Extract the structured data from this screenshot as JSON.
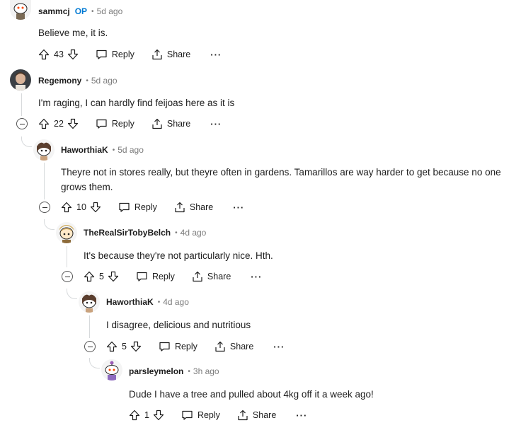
{
  "comments": [
    {
      "author": "sammcj",
      "op_label": "OP",
      "age": "5d ago",
      "body": "Believe me, it is.",
      "votes": "43",
      "reply": "Reply",
      "share": "Share"
    },
    {
      "author": "Regemony",
      "age": "5d ago",
      "body": "I'm raging, I can hardly find feijoas here as it is",
      "votes": "22",
      "reply": "Reply",
      "share": "Share"
    },
    {
      "author": "HaworthiaK",
      "age": "5d ago",
      "body": "Theyre not in stores really, but theyre often in gardens. Tamarillos are way harder to get because no one grows them.",
      "votes": "10",
      "reply": "Reply",
      "share": "Share"
    },
    {
      "author": "TheRealSirTobyBelch",
      "age": "4d ago",
      "body": "It's because they're not particularly nice. Hth.",
      "votes": "5",
      "reply": "Reply",
      "share": "Share"
    },
    {
      "author": "HaworthiaK",
      "age": "4d ago",
      "body": "I disagree, delicious and nutritious",
      "votes": "5",
      "reply": "Reply",
      "share": "Share"
    },
    {
      "author": "parsleymelon",
      "age": "3h ago",
      "body": "Dude I have a tree and pulled about 4kg off it a week ago!",
      "votes": "1",
      "reply": "Reply",
      "share": "Share"
    }
  ],
  "more_label": "···",
  "separator": "•",
  "icons": {
    "upvote": "upvote-icon",
    "downvote": "downvote-icon",
    "reply": "reply-icon",
    "share": "share-icon",
    "collapse": "collapse-icon"
  },
  "colors": {
    "op": "#0079d3",
    "meta": "#7c7c7c",
    "thread": "#d7dadc"
  }
}
